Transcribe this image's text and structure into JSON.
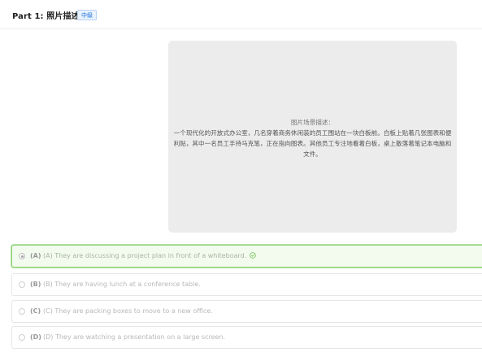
{
  "header": {
    "title": "Part 1: 照片描述题",
    "level_badge": "中级"
  },
  "image": {
    "label": "图片场景描述：",
    "description": "一个现代化的开放式办公室，几名穿着商务休闲装的员工围站在一块白板前。白板上贴着几张图表和便利贴，其中一名员工手持马克笔，正在指向图表。其他员工专注地看着白板，桌上散落着笔记本电脑和文件。"
  },
  "options": [
    {
      "letter": "(A)",
      "text": "(A) They are discussing a project plan in front of a whiteboard.",
      "selected": true,
      "correct": true
    },
    {
      "letter": "(B)",
      "text": "(B) They are having lunch at a conference table.",
      "selected": false
    },
    {
      "letter": "(C)",
      "text": "(C) They are packing boxes to move to a new office.",
      "selected": false
    },
    {
      "letter": "(D)",
      "text": "(D) They are watching a presentation on a large screen.",
      "selected": false
    }
  ],
  "colors": {
    "selected_border": "#8fd076",
    "selected_bg": "#f3fbef",
    "badge_blue": "#1a6fd8",
    "image_bg": "#ececec"
  }
}
